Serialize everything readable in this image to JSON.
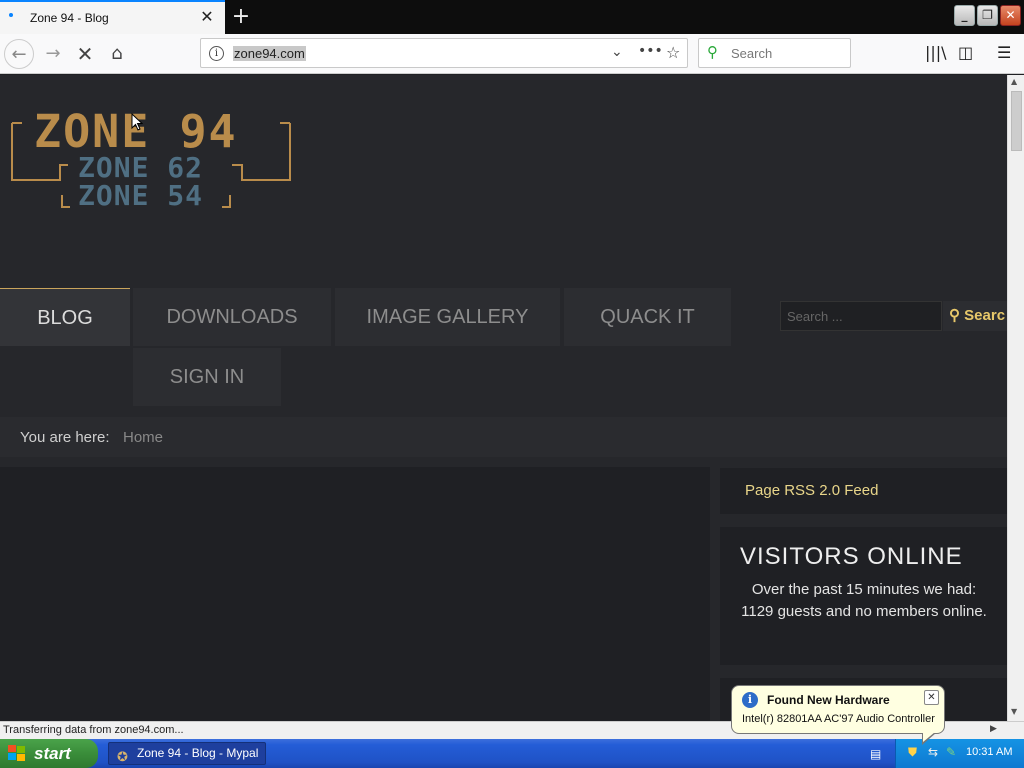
{
  "browser": {
    "tab": {
      "title": "Zone 94 - Blog"
    },
    "url": "zone94.com",
    "search_placeholder": "Search"
  },
  "site": {
    "logo": {
      "line1": "ZONE 94",
      "line2": "ZONE 62",
      "line3": "ZONE 54"
    },
    "nav": {
      "items": [
        {
          "label": "BLOG"
        },
        {
          "label": "DOWNLOADS"
        },
        {
          "label": "IMAGE GALLERY"
        },
        {
          "label": "QUACK IT"
        },
        {
          "label": "SIGN IN"
        }
      ]
    },
    "search": {
      "placeholder": "Search ...",
      "button_label": "Searc"
    },
    "breadcrumb": {
      "label": "You are here:",
      "home": "Home"
    },
    "sidebar": {
      "rss_label": "Page RSS 2.0 Feed",
      "visitors_title": "VISITORS ONLINE",
      "visitors_text": "Over the past 15 minutes we had: 1129 guests and no members online."
    }
  },
  "status": {
    "text": "Transferring data from zone94.com..."
  },
  "taskbar": {
    "start_label": "start",
    "task_label": "Zone 94 - Blog - Mypal",
    "clock": "10:31 AM"
  },
  "balloon": {
    "title": "Found New Hardware",
    "text": "Intel(r) 82801AA AC'97 Audio Controller"
  }
}
